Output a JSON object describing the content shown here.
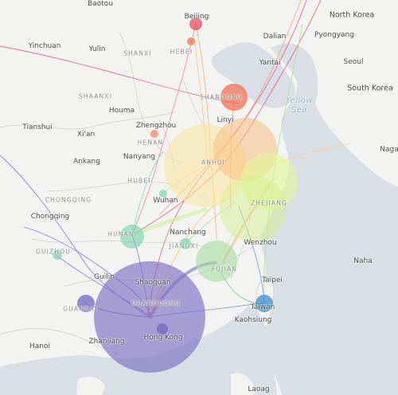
{
  "labels": {
    "countries": [
      {
        "id": "north-korea",
        "name": "North Korea"
      },
      {
        "id": "south-korea",
        "name": "South Korea"
      }
    ],
    "seas": [
      {
        "id": "yellow-sea",
        "name": "Yellow\nSea"
      }
    ],
    "provinces": [
      {
        "id": "shanxi",
        "name": "SHANXI"
      },
      {
        "id": "hebei",
        "name": "HEBEI"
      },
      {
        "id": "shaanxi",
        "name": "SHAANXI"
      },
      {
        "id": "shandong",
        "name": "SHANDONG"
      },
      {
        "id": "henan",
        "name": "HENAN"
      },
      {
        "id": "hubei",
        "name": "HUBEI"
      },
      {
        "id": "anhui",
        "name": "ANHUI"
      },
      {
        "id": "chongqing",
        "name": "CHONGQING"
      },
      {
        "id": "hunan",
        "name": "HUNAN"
      },
      {
        "id": "jiangxi",
        "name": "JIANGXI"
      },
      {
        "id": "zhejiang",
        "name": "ZHEJIANG"
      },
      {
        "id": "guizhou",
        "name": "GUIZHOU"
      },
      {
        "id": "fujian",
        "name": "FUJIAN"
      },
      {
        "id": "guangdong",
        "name": "GUANGDONG"
      },
      {
        "id": "guangxi",
        "name": "GUANGXI"
      }
    ],
    "cities": [
      {
        "id": "baotou",
        "name": "Baotou"
      },
      {
        "id": "beijing",
        "name": "Beijing"
      },
      {
        "id": "yinchuan",
        "name": "Yinchuan"
      },
      {
        "id": "yulin",
        "name": "Yulin"
      },
      {
        "id": "dalian",
        "name": "Dalian"
      },
      {
        "id": "pyongyang",
        "name": "Pyongyang"
      },
      {
        "id": "yantai",
        "name": "Yantai"
      },
      {
        "id": "seoul",
        "name": "Seoul"
      },
      {
        "id": "houma",
        "name": "Houma"
      },
      {
        "id": "linyi",
        "name": "Linyi"
      },
      {
        "id": "tianshui",
        "name": "Tianshui"
      },
      {
        "id": "zhengzhou",
        "name": "Zhengzhou"
      },
      {
        "id": "xian",
        "name": "Xi'an"
      },
      {
        "id": "nagano",
        "name": "Naga"
      },
      {
        "id": "ankang",
        "name": "Ankang"
      },
      {
        "id": "nanyang",
        "name": "Nanyang"
      },
      {
        "id": "wuhan",
        "name": "Wuhan"
      },
      {
        "id": "chongqing-city",
        "name": "Chongqing"
      },
      {
        "id": "nanchang",
        "name": "Nanchang"
      },
      {
        "id": "wenzhou",
        "name": "Wenzhou"
      },
      {
        "id": "naha",
        "name": "Naha"
      },
      {
        "id": "guilin",
        "name": "Guilin"
      },
      {
        "id": "shaoguan",
        "name": "Shaoguan"
      },
      {
        "id": "taipei",
        "name": "Taipei"
      },
      {
        "id": "taiwan",
        "name": "Taiwan"
      },
      {
        "id": "kaohsiung",
        "name": "Kaohsiung"
      },
      {
        "id": "hong-kong",
        "name": "Hong Kong"
      },
      {
        "id": "zhanjiang",
        "name": "Zhanjiang"
      },
      {
        "id": "hanoi",
        "name": "Hanoi"
      },
      {
        "id": "laoag",
        "name": "Laoag"
      }
    ]
  },
  "colors": {
    "land": "#f3f3f2",
    "water": "#d9dfe4",
    "border": "#c7c7c7",
    "guangdong": "#7b6fc2",
    "zhejiang": "#d7f08a",
    "anhui": "#fbe6a0",
    "jiangsu": "#f7d48c",
    "shandong": "#f18a5b",
    "beijing": "#e8556b",
    "fujian": "#a8dca0",
    "hunan": "#7cd3b0",
    "taiwan": "#3e8ec9",
    "guangxi": "#7b6fc2"
  }
}
